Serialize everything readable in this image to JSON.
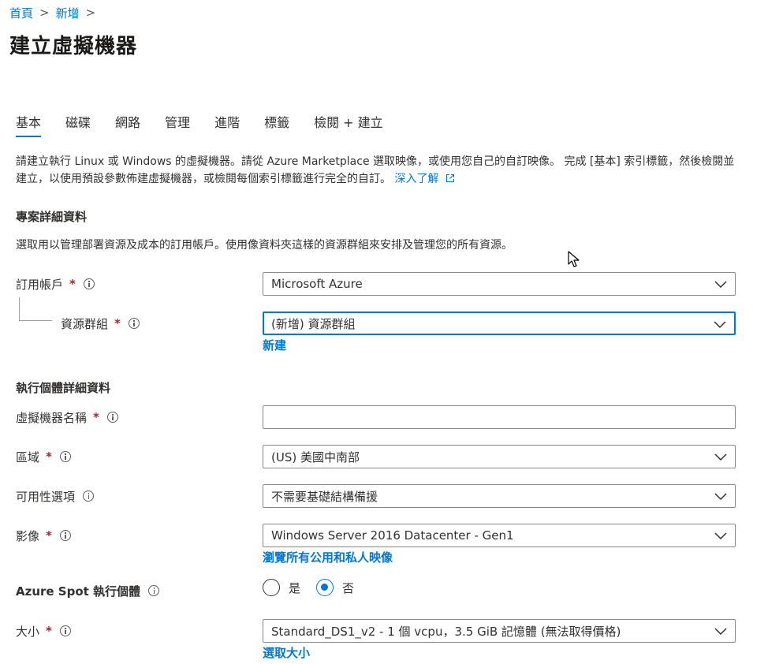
{
  "breadcrumb": {
    "home": "首頁",
    "new": "新增",
    "sep": ">"
  },
  "page_title": "建立虛擬機器",
  "tabs": [
    {
      "label": "基本",
      "active": true
    },
    {
      "label": "磁碟"
    },
    {
      "label": "網路"
    },
    {
      "label": "管理"
    },
    {
      "label": "進階"
    },
    {
      "label": "標籤"
    },
    {
      "label": "檢閱 + 建立"
    }
  ],
  "intro": {
    "text": "請建立執行 Linux 或 Windows 的虛擬機器。請從 Azure Marketplace 選取映像，或使用您自己的自訂映像。 完成 [基本] 索引標籤，然後檢閱並建立，以使用預設參數佈建虛擬機器，或檢閱每個索引標籤進行完全的自訂。 ",
    "learn_more": "深入了解"
  },
  "project": {
    "title": "專案詳細資料",
    "desc": "選取用以管理部署資源及成本的訂用帳戶。使用像資料夾這樣的資源群組來安排及管理您的所有資源。",
    "subscription_label": "訂用帳戶",
    "subscription_value": "Microsoft Azure",
    "rg_label": "資源群組",
    "rg_value": "(新增) 資源群組",
    "rg_new_link": "新建"
  },
  "instance": {
    "title": "執行個體詳細資料",
    "vm_name_label": "虛擬機器名稱",
    "vm_name_value": "",
    "region_label": "區域",
    "region_value": "(US) 美國中南部",
    "availability_label": "可用性選項",
    "availability_value": "不需要基礎結構備援",
    "image_label": "影像",
    "image_value": "Windows Server 2016 Datacenter - Gen1",
    "image_link": "瀏覽所有公用和私人映像",
    "spot_label": "Azure Spot 執行個體",
    "spot_yes": "是",
    "spot_no": "否",
    "spot_selected": "否",
    "size_label": "大小",
    "size_value": "Standard_DS1_v2 - 1 個 vcpu，3.5 GiB 記憶體 (無法取得價格)",
    "size_link": "選取大小"
  },
  "required_mark": "*",
  "colors": {
    "accent": "#0078d4",
    "required": "#a4262c",
    "text": "#323130",
    "border": "#8a8886"
  },
  "icons": [
    "info-icon",
    "chevron-down-icon",
    "external-link-icon",
    "mouse-cursor-icon"
  ]
}
